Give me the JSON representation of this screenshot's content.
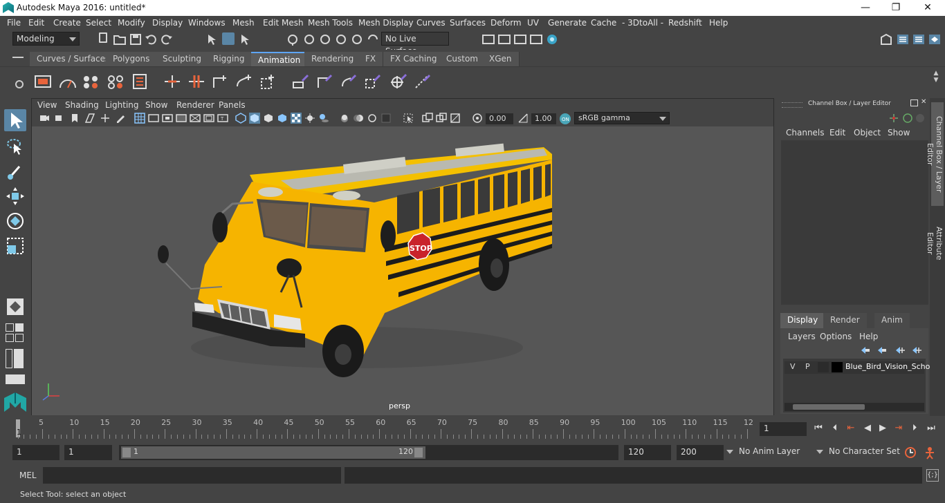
{
  "window": {
    "title": "Autodesk Maya 2016: untitled*",
    "minimize": "—",
    "maximize": "❐",
    "close": "✕"
  },
  "menubar": [
    "File",
    "Edit",
    "Create",
    "Select",
    "Modify",
    "Display",
    "Windows",
    "Mesh",
    "Edit Mesh",
    "Mesh Tools",
    "Mesh Display",
    "Curves",
    "Surfaces",
    "Deform",
    "UV",
    "Generate",
    "Cache",
    "- 3DtoAll -",
    "Redshift",
    "Help"
  ],
  "statusline": {
    "mode": "Modeling",
    "live_surface": "No Live Surface"
  },
  "shelf_tabs": [
    "Curves / Surfaces",
    "Polygons",
    "Sculpting",
    "Rigging",
    "Animation",
    "Rendering",
    "FX",
    "FX Caching",
    "Custom",
    "XGen"
  ],
  "active_shelf_tab": "Animation",
  "viewport": {
    "menu": [
      "View",
      "Shading",
      "Lighting",
      "Show",
      "Renderer",
      "Panels"
    ],
    "exposure": "0.00",
    "gamma": "1.00",
    "color_space": "sRGB gamma",
    "camera": "persp",
    "stop_sign": "STOP"
  },
  "channel_box": {
    "title": "Channel Box / Layer Editor",
    "menu": [
      "Channels",
      "Edit",
      "Object",
      "Show"
    ],
    "tabs": [
      "Display",
      "Render",
      "Anim"
    ],
    "active_tab": "Display",
    "layer_menu": [
      "Layers",
      "Options",
      "Help"
    ],
    "layer": {
      "v": "V",
      "p": "P",
      "name": "Blue_Bird_Vision_Scho"
    }
  },
  "side_tabs": [
    "Channel Box / Layer Editor",
    "Attribute Editor"
  ],
  "timeline": {
    "ticks": [
      "5",
      "10",
      "15",
      "20",
      "25",
      "30",
      "35",
      "40",
      "45",
      "50",
      "55",
      "60",
      "65",
      "70",
      "75",
      "80",
      "85",
      "90",
      "95",
      "100",
      "105",
      "110",
      "115",
      "12"
    ],
    "current_frame": "1",
    "start_marker": "1"
  },
  "range": {
    "start": "1",
    "playback_start": "1",
    "slider_start": "1",
    "slider_end": "120",
    "playback_end": "120",
    "end": "200",
    "anim_layer": "No Anim Layer",
    "character_set": "No Character Set"
  },
  "command_line": {
    "label": "MEL"
  },
  "help_line": "Select Tool: select an object"
}
